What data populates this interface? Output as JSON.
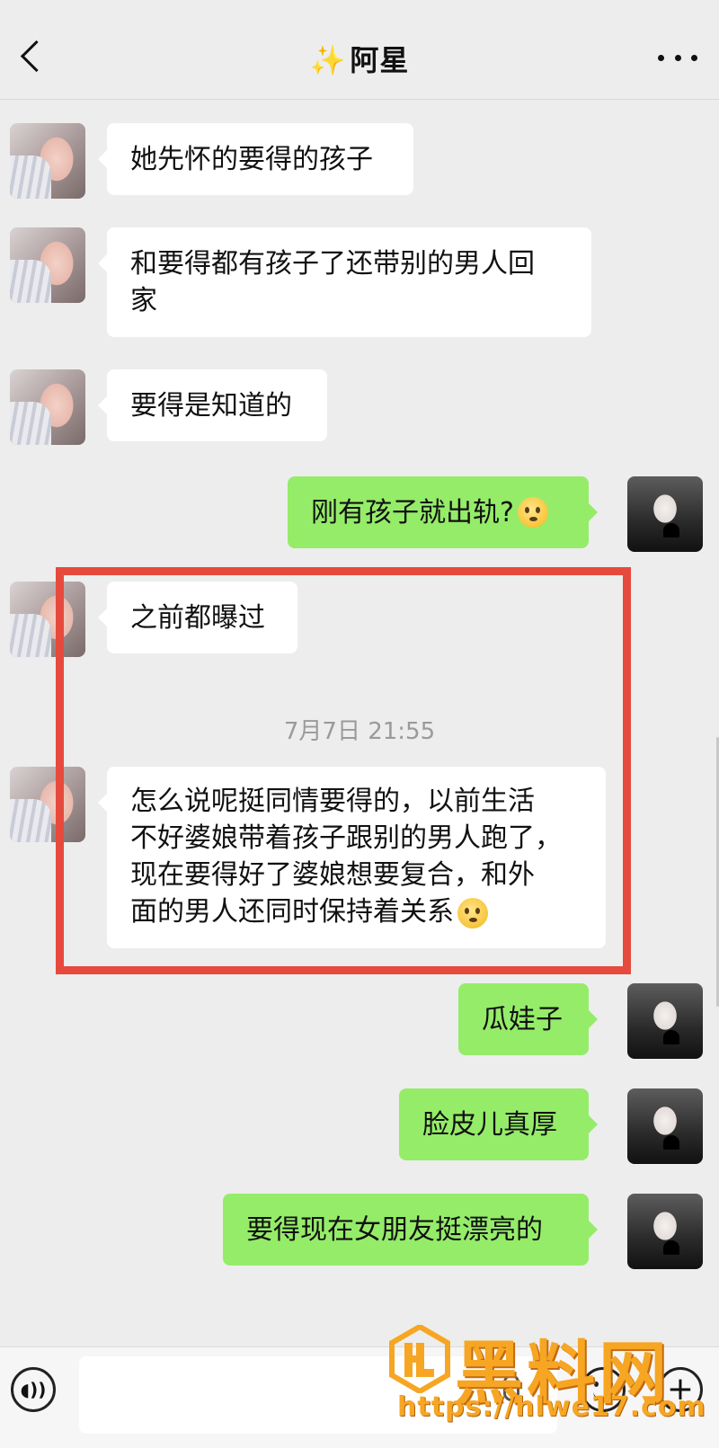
{
  "header": {
    "title": "阿星",
    "title_prefix_icon": "sparkles-emoji"
  },
  "messages": [
    {
      "side": "left",
      "text": "她先怀的要得的孩子"
    },
    {
      "side": "left",
      "text": "和要得都有孩子了还带别的男人回家"
    },
    {
      "side": "left",
      "text": "要得是知道的"
    },
    {
      "side": "right",
      "text": "刚有孩子就出轨?",
      "emoji": "pleading-face-emoji"
    },
    {
      "side": "left",
      "text": "之前都曝过"
    },
    {
      "side": "left",
      "text": "怎么说呢挺同情要得的，以前生活不好婆娘带着孩子跟别的男人跑了，现在要得好了婆娘想要复合，和外面的男人还同时保持着关系",
      "emoji": "sighing-face-emoji"
    },
    {
      "side": "right",
      "text": "瓜娃子"
    },
    {
      "side": "right",
      "text": "脸皮儿真厚"
    },
    {
      "side": "right",
      "text": "要得现在女朋友挺漂亮的"
    }
  ],
  "timestamp": "7月7日 21:55",
  "bubble_lines": {
    "m1": [
      "和要得都有孩子了还带别的男人回",
      "家"
    ],
    "m5": [
      "怎么说呢挺同情要得的，以前生活",
      "不好婆娘带着孩子跟别的男人跑了，",
      "现在要得好了婆娘想要复合，和外",
      "面的男人还同时保持着关系"
    ]
  },
  "watermark": {
    "title": "黑料网",
    "url": "https://hlwe17.com",
    "logo": "hl-logo-icon"
  },
  "colors": {
    "background": "#ededed",
    "left_bubble": "#ffffff",
    "right_bubble": "#95ec69",
    "highlight_box": "#e64a3d",
    "watermark": "#f6a623"
  }
}
